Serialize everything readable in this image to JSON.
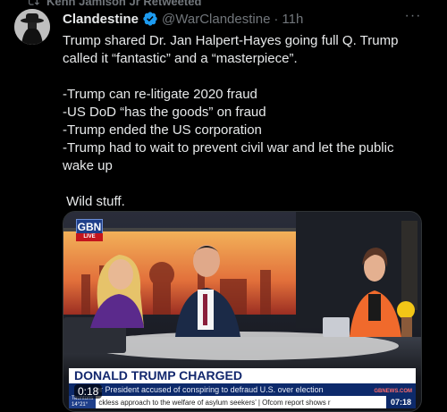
{
  "retweet": {
    "label": "Kenn Jamison Jr Retweeted"
  },
  "tweet": {
    "author_name": "Clandestine",
    "handle": "@WarClandestine",
    "separator": "·",
    "time": "11h",
    "more_label": "···",
    "paragraphs": [
      "Trump shared Dr. Jan Halpert-Hayes going full Q. Trump called it “fantastic” and a “masterpiece”.",
      "-Trump can re-litigate 2020 fraud\n-US DoD “has the goods” on fraud\n-Trump ended the US corporation\n-Trump had to wait to prevent civil war and let the public wake up",
      " Wild stuff."
    ]
  },
  "video": {
    "channel_logo": "GBN",
    "live_label": "LIVE",
    "headline": "DONALD TRUMP CHARGED",
    "subline": "er President accused of conspiring to defraud U.S. over election",
    "channel_site": "GBNEWS.COM",
    "ticker_tag_line1": "Tauntons",
    "ticker_tag_line2": "14°21°",
    "ticker_text": "ckless approach to the welfare of asylum seekers’ | Ofcom report shows r",
    "ticker_clock": "07:18",
    "elapsed_time": "0:18",
    "colors": {
      "headline_text": "#13286e",
      "lower_third_bg": "#0d2a6b",
      "live_red": "#c4141c"
    }
  },
  "icons": {
    "retweet": "retweet-icon",
    "verified": "verified-badge-icon",
    "more": "more-icon"
  }
}
